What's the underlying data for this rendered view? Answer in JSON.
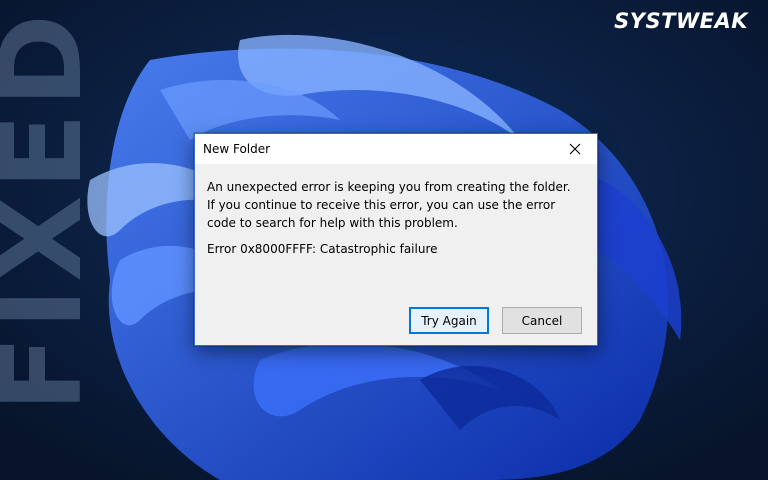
{
  "overlay": {
    "headline": "FIXED",
    "brand": "SYSTWEAK"
  },
  "dialog": {
    "title": "New Folder",
    "message": "An unexpected error is keeping you from creating the folder. If you continue to receive this error, you can use the error code to search for help with this problem.",
    "error_line": "Error 0x8000FFFF: Catastrophic failure",
    "buttons": {
      "try_again": "Try Again",
      "cancel": "Cancel"
    }
  },
  "colors": {
    "accent": "#0078d7",
    "background": "#0a1a33",
    "bloom": "#1e4ee0"
  }
}
